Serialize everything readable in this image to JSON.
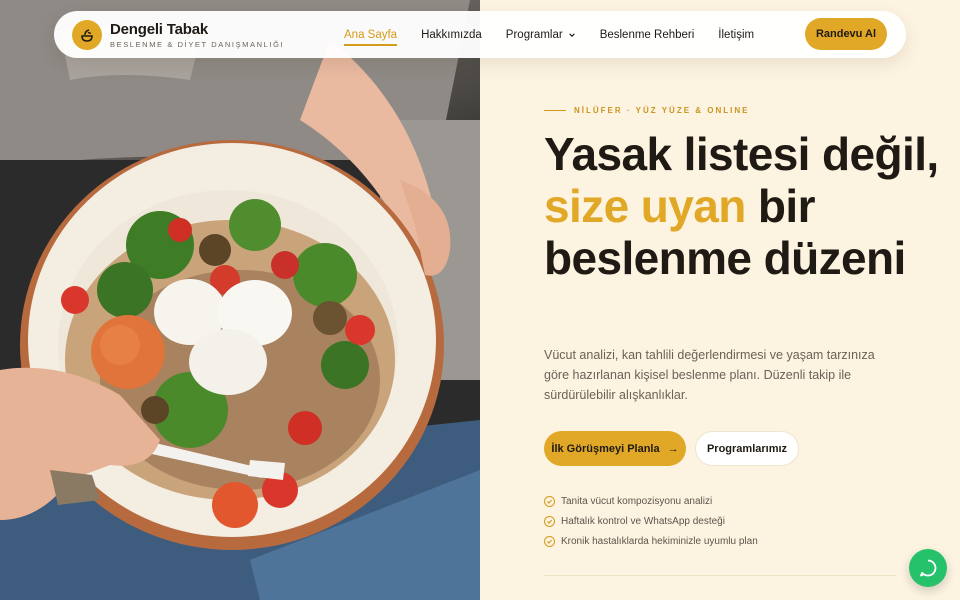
{
  "brand": {
    "name": "Dengeli Tabak",
    "tagline": "BESLENME & DİYET DANIŞMANLIĞI",
    "accent": "#e0a826"
  },
  "nav": {
    "items": [
      {
        "label": "Ana Sayfa",
        "active": true
      },
      {
        "label": "Hakkımızda"
      },
      {
        "label": "Programlar",
        "icon": "chevron-down-icon"
      },
      {
        "label": "Beslenme Rehberi"
      },
      {
        "label": "İletişim"
      }
    ],
    "cta": "Randevu Al"
  },
  "hero": {
    "eyebrow": "NİLÜFER · YÜZ YÜZE & ONLINE",
    "title_part1": "Yasak listesi değil,",
    "title_accent": "size uyan",
    "title_part2": "bir beslenme düzeni",
    "lead": "Vücut analizi, kan tahlili değerlendirmesi ve yaşam tarzınıza göre hazırlanan kişisel beslenme planı. Düzenli takip ile sürdürülebilir alışkanlıklar.",
    "primary_cta": "İlk Görüşmeyi Planla",
    "secondary_cta": "Programlarımız",
    "features": [
      "Tanita vücut kompozisyonu analizi",
      "Haftalık kontrol ve WhatsApp desteği",
      "Kronik hastalıklarda hekiminizle uyumlu plan"
    ]
  },
  "whatsapp": {
    "icon": "whatsapp-icon",
    "color": "#25c16b"
  }
}
